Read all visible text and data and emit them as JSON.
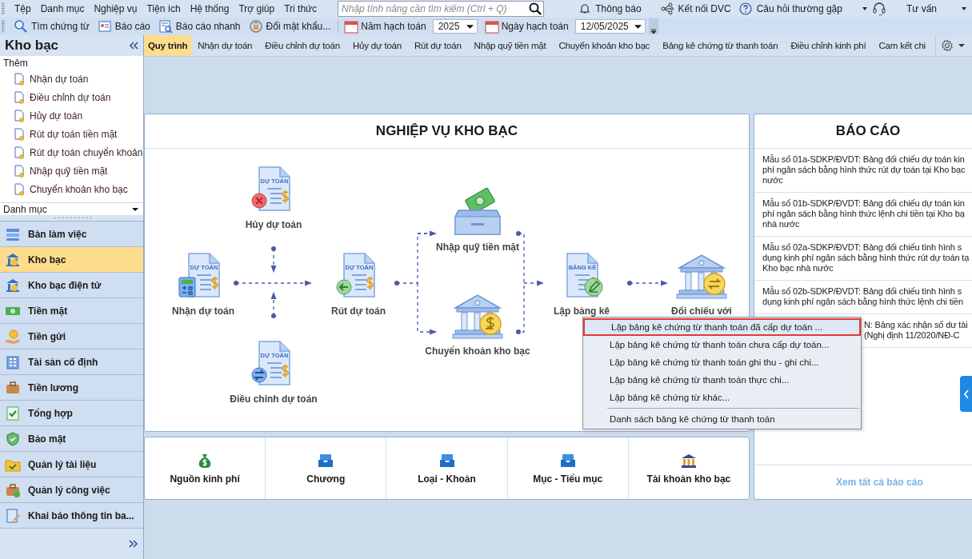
{
  "menu_bar": {
    "items": [
      "Tệp",
      "Danh mục",
      "Nghiệp vụ",
      "Tiện ích",
      "Hệ thống",
      "Trợ giúp",
      "Tri thức"
    ],
    "search": {
      "placeholder": "Nhập tính năng cần tìm kiếm (Ctrl + Q)"
    },
    "notifications": "Thông báo",
    "connect": "Kết nối DVC",
    "faq": "Câu hỏi thường gặp",
    "support": "Tư vấn"
  },
  "toolbar": {
    "buttons": [
      {
        "kind": "search",
        "label": "Tìm chứng từ"
      },
      {
        "kind": "report",
        "label": "Báo cáo"
      },
      {
        "kind": "quick-report",
        "label": "Báo cáo nhanh"
      },
      {
        "kind": "password",
        "label": "Đổi mật khẩu..."
      }
    ],
    "year_label": "Năm hạch toán",
    "year": "2025",
    "date_label": "Ngày hạch toán",
    "date": "12/05/2025"
  },
  "sidebar": {
    "title": "Kho bạc",
    "add_label": "Thêm",
    "add_items": [
      "Nhận dự toán",
      "Điều chỉnh dự toán",
      "Hủy dự toán",
      "Rút dự toán tiền mặt",
      "Rút dự toán chuyển khoản",
      "Nhập quỹ tiền mặt",
      "Chuyển khoản kho bạc"
    ],
    "category_select": "Danh mục",
    "nav": [
      {
        "kind": "desk",
        "label": "Bàn làm việc",
        "selected": false
      },
      {
        "kind": "bank",
        "label": "Kho bạc",
        "selected": true
      },
      {
        "kind": "ebank",
        "label": "Kho bạc điện tử",
        "selected": false
      },
      {
        "kind": "cash",
        "label": "Tiền mặt",
        "selected": false
      },
      {
        "kind": "deposit",
        "label": "Tiền gửi",
        "selected": false
      },
      {
        "kind": "asset",
        "label": "Tài sản cố định",
        "selected": false
      },
      {
        "kind": "salary",
        "label": "Tiền lương",
        "selected": false
      },
      {
        "kind": "summary",
        "label": "Tổng hợp",
        "selected": false
      },
      {
        "kind": "security",
        "label": "Bảo mật",
        "selected": false
      },
      {
        "kind": "docs",
        "label": "Quản lý tài liệu",
        "selected": false
      },
      {
        "kind": "tasks",
        "label": "Quản lý công việc",
        "selected": false
      },
      {
        "kind": "info",
        "label": "Khai báo thông tin ba...",
        "selected": false
      }
    ]
  },
  "tabs": [
    {
      "label": "Quy trình",
      "selected": true
    },
    {
      "label": "Nhận dự toán",
      "selected": false
    },
    {
      "label": "Điều chỉnh dự toán",
      "selected": false
    },
    {
      "label": "Hủy dự toán",
      "selected": false
    },
    {
      "label": "Rút dự toán",
      "selected": false
    },
    {
      "label": "Nhập quỹ tiền mặt",
      "selected": false
    },
    {
      "label": "Chuyển khoản kho bạc",
      "selected": false
    },
    {
      "label": "Bảng kê chứng từ thanh toán",
      "selected": false
    },
    {
      "label": "Điều chỉnh kinh phí",
      "selected": false
    },
    {
      "label": "Cam kết chi",
      "selected": false
    }
  ],
  "process": {
    "title": "NGHIỆP VỤ KHO BẠC",
    "nodes": [
      {
        "kind": "doc-cancel",
        "caption": "DỰ TOÁN",
        "label": "Hủy dự toán"
      },
      {
        "kind": "doc-calc",
        "caption": "DỰ TOÁN",
        "label": "Nhận dự toán"
      },
      {
        "kind": "doc-back",
        "caption": "DỰ TOÁN",
        "label": "Rút dự toán"
      },
      {
        "kind": "doc-swap",
        "caption": "DỰ TOÁN",
        "label": "Điều chỉnh dự toán"
      },
      {
        "kind": "cash-drawer",
        "label": "Nhập quỹ tiền mặt"
      },
      {
        "kind": "bank-dollar",
        "label": "Chuyển khoản kho bạc"
      },
      {
        "kind": "doc-edit",
        "caption": "BẢNG KÊ",
        "label": "Lập bảng kê"
      },
      {
        "kind": "bank-swap",
        "label": "Đối chiếu với"
      }
    ]
  },
  "categories": [
    {
      "kind": "money-bag",
      "label": "Nguồn kinh phí"
    },
    {
      "kind": "tray",
      "label": "Chương"
    },
    {
      "kind": "tray",
      "label": "Loại - Khoản"
    },
    {
      "kind": "tray",
      "label": "Mục - Tiểu mục"
    },
    {
      "kind": "bank",
      "label": "Tài khoản kho bạc"
    }
  ],
  "reports": {
    "title": "BÁO CÁO",
    "items": [
      {
        "kind": "full",
        "lines": [
          "Mẫu số 01a-SDKP/ĐVDT: Bảng đối chiếu dự toán kin",
          "phí ngân sách bằng hình thức rút dự toán tại Kho bạc",
          "nước"
        ]
      },
      {
        "kind": "full",
        "lines": [
          "Mẫu số 01b-SDKP/ĐVDT: Bảng đối chiếu dự toán kin",
          "phí ngân sách bằng hình thức lệnh chi tiền tại Kho bạ",
          "nhà nước"
        ]
      },
      {
        "kind": "full",
        "lines": [
          "Mẫu số 02a-SDKP/ĐVDT: Bảng đối chiếu tình hình s",
          "dụng kinh phí ngân sách bằng hình thức rút dự toán tạ",
          "Kho bạc nhà nước"
        ]
      },
      {
        "kind": "full",
        "lines": [
          "Mẫu số 02b-SDKP/ĐVDT: Bảng đối chiếu tình hình s",
          "dụng kinh phí ngân sách bằng hình thức lệnh chi tiền"
        ]
      },
      {
        "kind": "partial",
        "lines": [
          "N: Bảng xác nhận số dư tài",
          "(Nghị định 11/2020/NĐ-C"
        ]
      }
    ],
    "view_all": "Xem tất cả báo cáo"
  },
  "context_menu": {
    "items": [
      {
        "label": "Lập bảng kê chứng từ thanh toán đã cấp dự toán ...",
        "selected": true,
        "separator_before": false
      },
      {
        "label": "Lập bảng kê chứng từ thanh toán chưa cấp dự toán...",
        "selected": false,
        "separator_before": false
      },
      {
        "label": "Lập bảng kê chứng từ thanh toán ghi thu - ghi chi...",
        "selected": false,
        "separator_before": false
      },
      {
        "label": "Lập bảng kê chứng từ thanh toán thực chi...",
        "selected": false,
        "separator_before": false
      },
      {
        "label": "Lập bảng kê chứng từ khác...",
        "selected": false,
        "separator_before": false
      },
      {
        "label": "Danh sách bảng kê chứng từ thanh toán",
        "selected": false,
        "separator_before": true
      }
    ]
  }
}
